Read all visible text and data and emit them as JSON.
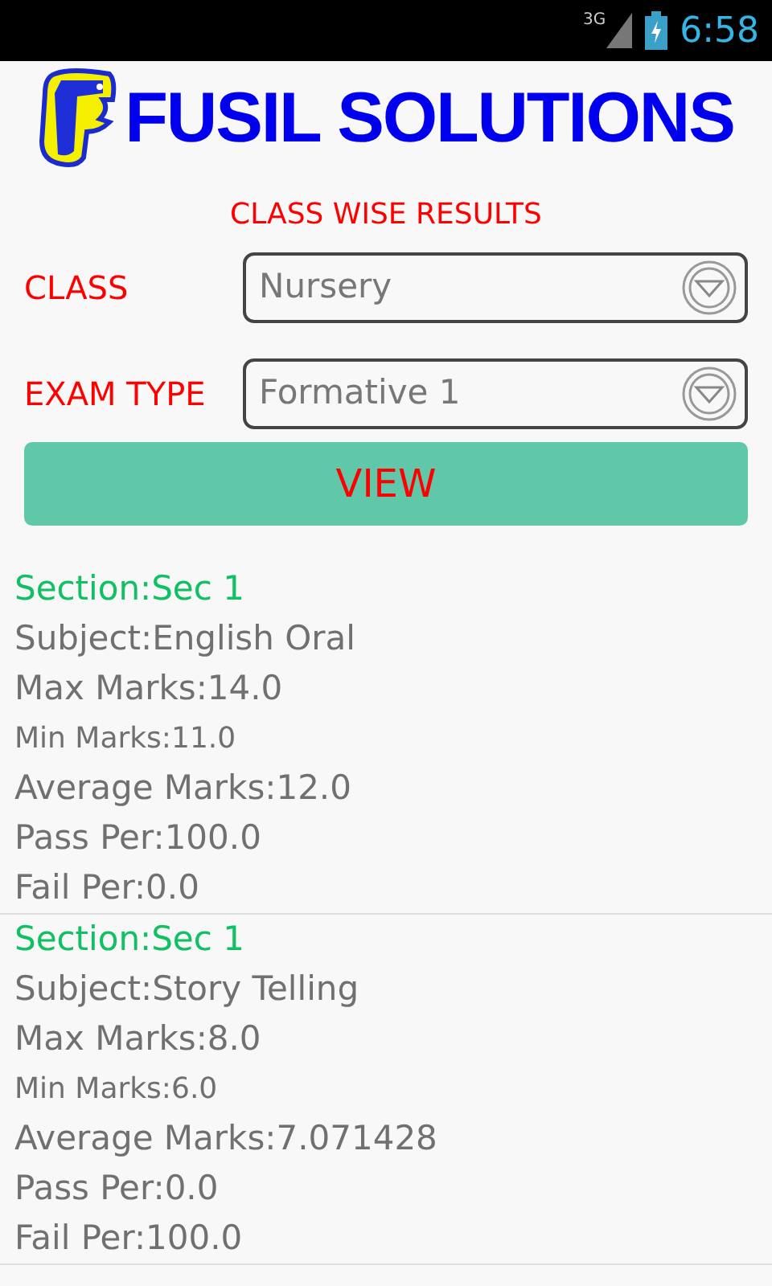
{
  "status_bar": {
    "network": "3G",
    "time": "6:58"
  },
  "brand": {
    "name": "FUSIL SOLUTIONS"
  },
  "page_title": "CLASS WISE RESULTS",
  "filters": [
    {
      "label": "CLASS",
      "value": "Nursery"
    },
    {
      "label": "EXAM TYPE",
      "value": "Formative 1"
    }
  ],
  "view_button": "VIEW",
  "results": [
    {
      "section": "Section:Sec 1",
      "subject": "Subject:English Oral",
      "max_marks": "Max Marks:14.0",
      "min_marks": "Min Marks:11.0",
      "average_marks": "Average Marks:12.0",
      "pass_per": "Pass Per:100.0",
      "fail_per": "Fail Per:0.0"
    },
    {
      "section": "Section:Sec 1",
      "subject": "Subject:Story Telling",
      "max_marks": "Max Marks:8.0",
      "min_marks": "Min Marks:6.0",
      "average_marks": "Average Marks:7.071428",
      "pass_per": "Pass Per:0.0",
      "fail_per": "Fail Per:100.0"
    }
  ]
}
